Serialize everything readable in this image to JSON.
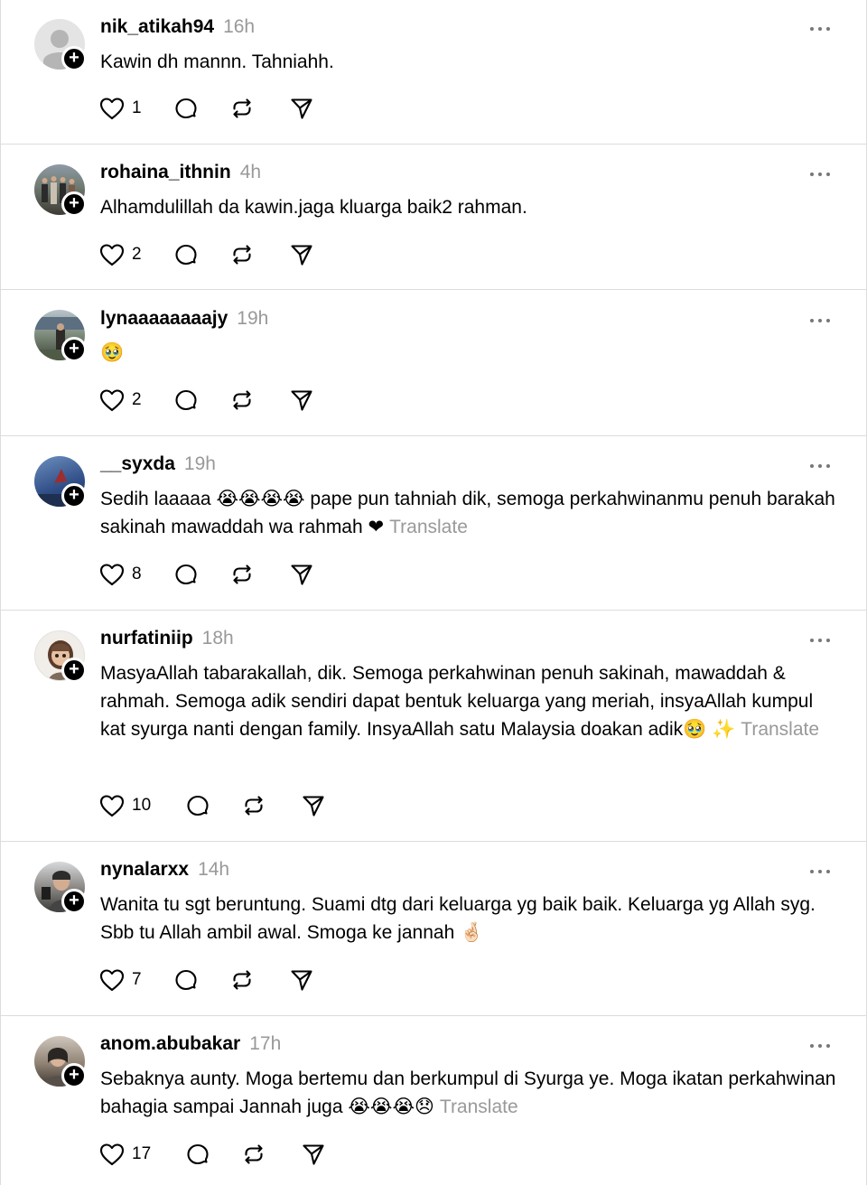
{
  "colors": {
    "divider": "#dcdcdc",
    "muted": "#999999",
    "badge": "#000000"
  },
  "icons": {
    "like": "heart-icon",
    "reply": "comment-bubble-icon",
    "repost": "repost-arrows-icon",
    "share": "send-plane-icon",
    "more": "more-dots-icon",
    "follow": "plus-icon"
  },
  "posts": [
    {
      "username": "nik_atikah94",
      "time": "16h",
      "text": "Kawin dh mannn. Tahniahh.",
      "likes": "1",
      "avatar": "default"
    },
    {
      "username": "rohaina_ithnin",
      "time": "4h",
      "text": "Alhamdulillah da kawin.jaga kluarga baik2 rahman.",
      "likes": "2",
      "avatar": "group-photo"
    },
    {
      "username": "lynaaaaaaaajy",
      "time": "19h",
      "text": "🥹",
      "likes": "2",
      "avatar": "outdoor-photo"
    },
    {
      "username": "__syxda",
      "time": "19h",
      "text": "Sedih laaaaa 😭😭😭😭 pape pun tahniah dik, semoga perkahwinanmu penuh barakah sakinah mawaddah wa rahmah ❤",
      "translate": "Translate",
      "likes": "8",
      "avatar": "blue-sky-photo"
    },
    {
      "username": "nurfatiniip",
      "time": "18h",
      "text": "MasyaAllah tabarakallah, dik. Semoga perkahwinan penuh sakinah, mawaddah & rahmah. Semoga adik sendiri dapat bentuk keluarga yang meriah, insyaAllah kumpul kat syurga nanti dengan family. InsyaAllah satu Malaysia doakan adik🥹 ✨",
      "translate": "Translate",
      "likes": "10",
      "avatar": "cartoon-avatar"
    },
    {
      "username": "nynalarxx",
      "time": "14h",
      "text": "Wanita tu sgt beruntung. Suami dtg dari keluarga yg baik baik. Keluarga yg Allah syg. Sbb tu Allah ambil awal. Smoga ke jannah 🤞🏻",
      "likes": "7",
      "avatar": "selfie-photo"
    },
    {
      "username": "anom.abubakar",
      "time": "17h",
      "text": "Sebaknya aunty. Moga bertemu dan berkumpul di Syurga ye. Moga ikatan perkahwinan bahagia sampai Jannah juga 😭😭😭😞",
      "translate": "Translate",
      "likes": "17",
      "avatar": "portrait-photo"
    }
  ]
}
